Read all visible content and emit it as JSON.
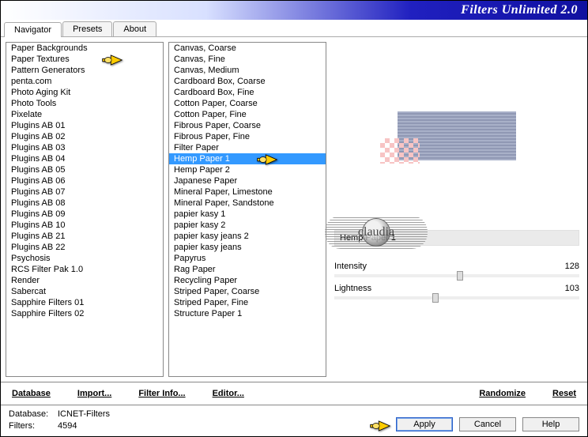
{
  "title": "Filters Unlimited 2.0",
  "tabs": [
    "Navigator",
    "Presets",
    "About"
  ],
  "active_tab_index": 0,
  "categories": [
    "Paper Backgrounds",
    "Paper Textures",
    "Pattern Generators",
    "penta.com",
    "Photo Aging Kit",
    "Photo Tools",
    "Pixelate",
    "Plugins AB 01",
    "Plugins AB 02",
    "Plugins AB 03",
    "Plugins AB 04",
    "Plugins AB 05",
    "Plugins AB 06",
    "Plugins AB 07",
    "Plugins AB 08",
    "Plugins AB 09",
    "Plugins AB 10",
    "Plugins AB 21",
    "Plugins AB 22",
    "Psychosis",
    "RCS Filter Pak 1.0",
    "Render",
    "Sabercat",
    "Sapphire Filters 01",
    "Sapphire Filters 02"
  ],
  "category_pointer_index": 1,
  "filters": [
    "Canvas, Coarse",
    "Canvas, Fine",
    "Canvas, Medium",
    "Cardboard Box, Coarse",
    "Cardboard Box, Fine",
    "Cotton Paper, Coarse",
    "Cotton Paper, Fine",
    "Fibrous Paper, Coarse",
    "Fibrous Paper, Fine",
    "Filter Paper",
    "Hemp Paper 1",
    "Hemp Paper 2",
    "Japanese Paper",
    "Mineral Paper, Limestone",
    "Mineral Paper, Sandstone",
    "papier kasy 1",
    "papier kasy 2",
    "papier kasy jeans 2",
    "papier kasy jeans",
    "Papyrus",
    "Rag Paper",
    "Recycling Paper",
    "Striped Paper, Coarse",
    "Striped Paper, Fine",
    "Structure Paper 1"
  ],
  "filter_selected_index": 10,
  "selected_filter_name": "Hemp Paper 1",
  "params": [
    {
      "label": "Intensity",
      "value": 128,
      "pct": 50
    },
    {
      "label": "Lightness",
      "value": 103,
      "pct": 40
    }
  ],
  "toolbar": {
    "database": "Database",
    "import": "Import...",
    "filter_info": "Filter Info...",
    "editor": "Editor...",
    "randomize": "Randomize",
    "reset": "Reset"
  },
  "footer": {
    "db_label": "Database:",
    "db_value": "ICNET-Filters",
    "filters_label": "Filters:",
    "filters_value": "4594",
    "apply": "Apply",
    "cancel": "Cancel",
    "help": "Help"
  },
  "watermark_text": "claudia"
}
